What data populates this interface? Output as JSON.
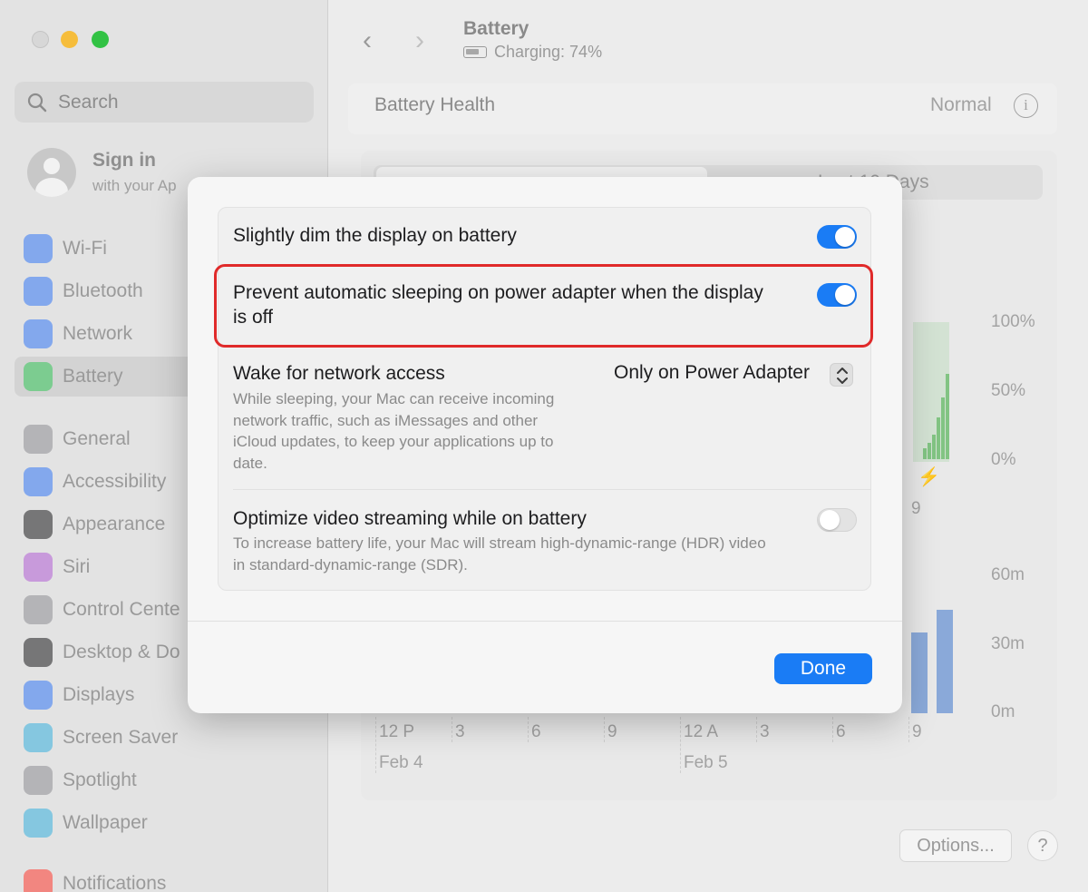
{
  "window": {
    "title": "Battery",
    "subtitle": "Charging: 74%"
  },
  "sidebar": {
    "search_placeholder": "Search",
    "signin_title": "Sign in",
    "signin_subtitle": "with your Ap",
    "items": [
      {
        "label": "Wi-Fi",
        "icon": "wifi-icon",
        "color": "#3478f6"
      },
      {
        "label": "Bluetooth",
        "icon": "bluetooth-icon",
        "color": "#3478f6"
      },
      {
        "label": "Network",
        "icon": "network-icon",
        "color": "#3478f6"
      },
      {
        "label": "Battery",
        "icon": "battery-icon",
        "color": "#34c759"
      },
      {
        "label": "General",
        "icon": "gear-icon",
        "color": "#8e8e93"
      },
      {
        "label": "Accessibility",
        "icon": "accessibility-icon",
        "color": "#3478f6"
      },
      {
        "label": "Appearance",
        "icon": "appearance-icon",
        "color": "#1d1d1f"
      },
      {
        "label": "Siri",
        "icon": "siri-icon",
        "color": "#b35fd6"
      },
      {
        "label": "Control Cente",
        "icon": "control-center-icon",
        "color": "#8e8e93"
      },
      {
        "label": "Desktop & Do",
        "icon": "desktop-icon",
        "color": "#1d1d1f"
      },
      {
        "label": "Displays",
        "icon": "displays-icon",
        "color": "#3478f6"
      },
      {
        "label": "Screen Saver",
        "icon": "screen-saver-icon",
        "color": "#38b0de"
      },
      {
        "label": "Spotlight",
        "icon": "spotlight-icon",
        "color": "#8e8e93"
      },
      {
        "label": "Wallpaper",
        "icon": "wallpaper-icon",
        "color": "#38b0de"
      },
      {
        "label": "Notifications",
        "icon": "notifications-icon",
        "color": "#ff3b30"
      }
    ]
  },
  "health": {
    "label": "Battery Health",
    "value": "Normal",
    "info": "i"
  },
  "chart": {
    "tab_right": "Last 10 Days",
    "level_ticks": [
      "100%",
      "50%",
      "0%"
    ],
    "usage_ticks": [
      "60m",
      "30m",
      "0m"
    ],
    "time_ticks": [
      "12 P",
      "3",
      "6",
      "9",
      "12 A",
      "3",
      "6",
      "9"
    ],
    "top_time_tick": "9",
    "dates": [
      "Feb 4",
      "Feb 5"
    ],
    "level_bar_fractions": [
      0.08,
      0.12,
      0.18,
      0.3,
      0.45,
      0.62
    ],
    "usage_bar_minutes": [
      35,
      45
    ]
  },
  "dialog": {
    "rows": {
      "dim": {
        "title": "Slightly dim the display on battery",
        "enabled": true
      },
      "prevent_sleep": {
        "title": "Prevent automatic sleeping on power adapter when the display is off",
        "enabled": true
      },
      "wake": {
        "title": "Wake for network access",
        "value": "Only on Power Adapter",
        "description": "While sleeping, your Mac can receive incoming network traffic, such as iMessages and other iCloud updates, to keep your applications up to date."
      },
      "optimize": {
        "title": "Optimize video streaming while on battery",
        "description": "To increase battery life, your Mac will stream high-dynamic-range (HDR) video in standard-dynamic-range (SDR).",
        "enabled": false
      }
    },
    "done_label": "Done"
  },
  "footer": {
    "options_label": "Options...",
    "help_label": "?"
  }
}
